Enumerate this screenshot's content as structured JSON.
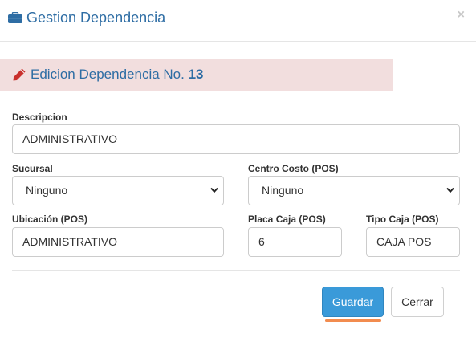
{
  "header": {
    "icon": "briefcase-icon",
    "title": "Gestion Dependencia",
    "close_label": "×"
  },
  "banner": {
    "icon": "pencil-icon",
    "title": "Edicion Dependencia No.",
    "number": "13"
  },
  "form": {
    "descripcion": {
      "label": "Descripcion",
      "value": "ADMINISTRATIVO"
    },
    "sucursal": {
      "label": "Sucursal",
      "value": "Ninguno"
    },
    "centro_costo": {
      "label": "Centro Costo (POS)",
      "value": "Ninguno"
    },
    "ubicacion": {
      "label": "Ubicación (POS)",
      "value": "ADMINISTRATIVO"
    },
    "placa_caja": {
      "label": "Placa Caja (POS)",
      "value": "6"
    },
    "tipo_caja": {
      "label": "Tipo Caja (POS)",
      "value": "CAJA POS"
    }
  },
  "footer": {
    "save_label": "Guardar",
    "close_label": "Cerrar"
  },
  "colors": {
    "title_blue": "#2e6da4",
    "banner_bg": "#f2dede",
    "primary_btn": "#3a9ad9",
    "focus_orange": "#f28c4f",
    "banner_icon": "#c9302c"
  }
}
